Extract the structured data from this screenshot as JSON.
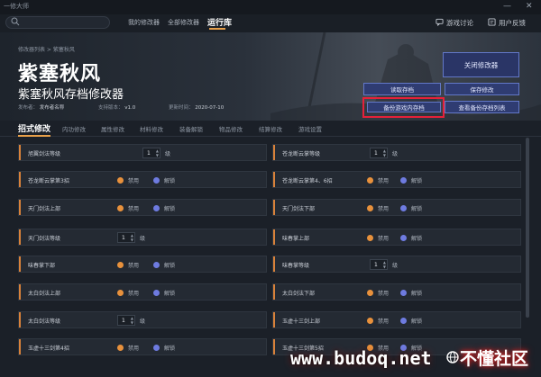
{
  "app_title": "一修大师",
  "window_controls": {
    "minimize": "—",
    "close": "✕"
  },
  "search": {
    "placeholder": ""
  },
  "top_nav": [
    "我的修改器",
    "全部修改器",
    "运行库"
  ],
  "header_links": {
    "discussion": "游戏讨论",
    "feedback": "用户反馈"
  },
  "breadcrumb": "修改器列表 > 紫塞秋风",
  "game_title": "紫塞秋风",
  "trainer_title": "紫塞秋风存档修改器",
  "meta": {
    "publisher_label": "发布者：",
    "publisher": "发布者名称",
    "version_label": "支持版本：",
    "version": "v1.0",
    "updated_label": "更新时间：",
    "updated": "2020-07-10"
  },
  "buttons": {
    "close": "关闭修改器",
    "read": "读取存档",
    "save": "保存修改",
    "backup": "备份游戏内存档",
    "list": "查看备份存档列表"
  },
  "tabs": [
    "招式修改",
    "内功修改",
    "属性修改",
    "材料修改",
    "装备解锁",
    "物品修改",
    "结算修改",
    "游戏设置"
  ],
  "rows": [
    {
      "label": "旭翼剑法等级",
      "value": "1",
      "unit": "级"
    },
    {
      "label": "苍龙断云掌等级",
      "value": "1",
      "unit": "级"
    },
    {
      "label": "苍龙断云掌第3招",
      "opt_on": "禁用",
      "opt_off": "解锁"
    },
    {
      "label": "苍龙断云掌第4、6招",
      "opt_on": "禁用",
      "opt_off": "解锁"
    },
    {
      "label": "天门剑法上部",
      "opt_on": "禁用",
      "opt_off": "解锁"
    },
    {
      "label": "天门剑法下部",
      "opt_on": "禁用",
      "opt_off": "解锁"
    },
    {
      "label": "天门剑法等级",
      "value": "1",
      "unit": "级"
    },
    {
      "label": "味春掌上部",
      "opt_on": "禁用",
      "opt_off": "解锁"
    },
    {
      "label": "味春掌下部",
      "opt_on": "禁用",
      "opt_off": "解锁"
    },
    {
      "label": "味春掌等级",
      "value": "1",
      "unit": "级"
    },
    {
      "label": "太白剑法上部",
      "opt_on": "禁用",
      "opt_off": "解锁"
    },
    {
      "label": "太白剑法下部",
      "opt_on": "禁用",
      "opt_off": "解锁"
    },
    {
      "label": "太白剑法等级",
      "value": "1",
      "unit": "级"
    },
    {
      "label": "玉虚十三剑上部",
      "opt_on": "禁用",
      "opt_off": "解锁"
    },
    {
      "label": "玉虚十三剑第4招",
      "opt_on": "禁用",
      "opt_off": "解锁"
    },
    {
      "label": "玉虚十三剑第5招",
      "opt_on": "禁用",
      "opt_off": "解锁"
    }
  ],
  "watermark": {
    "url": "www.budoq.net",
    "brand": "不懂社区"
  },
  "colors": {
    "accent": "#e8a04a",
    "button_border": "#6378c8",
    "highlight": "#e5213a",
    "radio_on": "#e8913c",
    "radio_off": "#6e7be0"
  }
}
